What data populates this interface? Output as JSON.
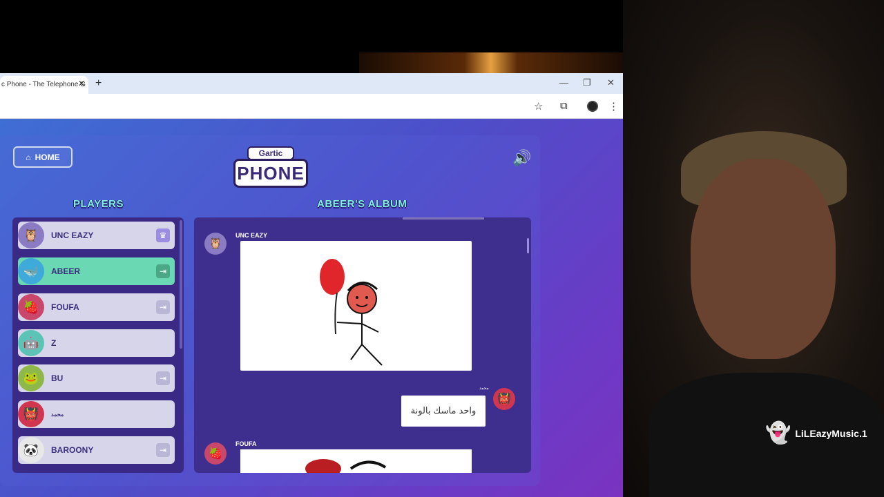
{
  "browser": {
    "tab_title": "c Phone - The Telephone G",
    "tab_close": "✕",
    "new_tab": "+",
    "window_controls": {
      "minimize": "—",
      "restore": "❐",
      "close": "✕"
    },
    "toolbar_icons": [
      "star-icon",
      "extensions-icon",
      "profile-avatar",
      "menu-icon"
    ]
  },
  "game": {
    "home_label": "HOME",
    "logo_top": "Gartic",
    "logo_main": "PHONE",
    "players_title": "PLAYERS",
    "album_title": "ABEER'S ALBUM",
    "players": [
      {
        "name": "UNC EAZY",
        "badge": "♛",
        "active": false
      },
      {
        "name": "ABEER",
        "badge": "⇥",
        "active": true
      },
      {
        "name": "FOUFA",
        "badge": "⇥",
        "active": false
      },
      {
        "name": "Z",
        "badge": "",
        "active": false
      },
      {
        "name": "BU",
        "badge": "⇥",
        "active": false
      },
      {
        "name": "محمد",
        "badge": "",
        "active": false
      },
      {
        "name": "BAROONY",
        "badge": "⇥",
        "active": false
      }
    ],
    "album": {
      "entry1_author": "UNC EAZY",
      "entry2_author": "محمد",
      "entry2_text": "واحد ماسك بالونة",
      "entry3_author": "FOUFA"
    }
  },
  "webcam": {
    "snapchat_handle": "LiLEazyMusic.1"
  },
  "colors": {
    "accent_teal": "#69d8b3",
    "title_cyan": "#7ff0e0",
    "panel_purple": "#3a2a86"
  }
}
